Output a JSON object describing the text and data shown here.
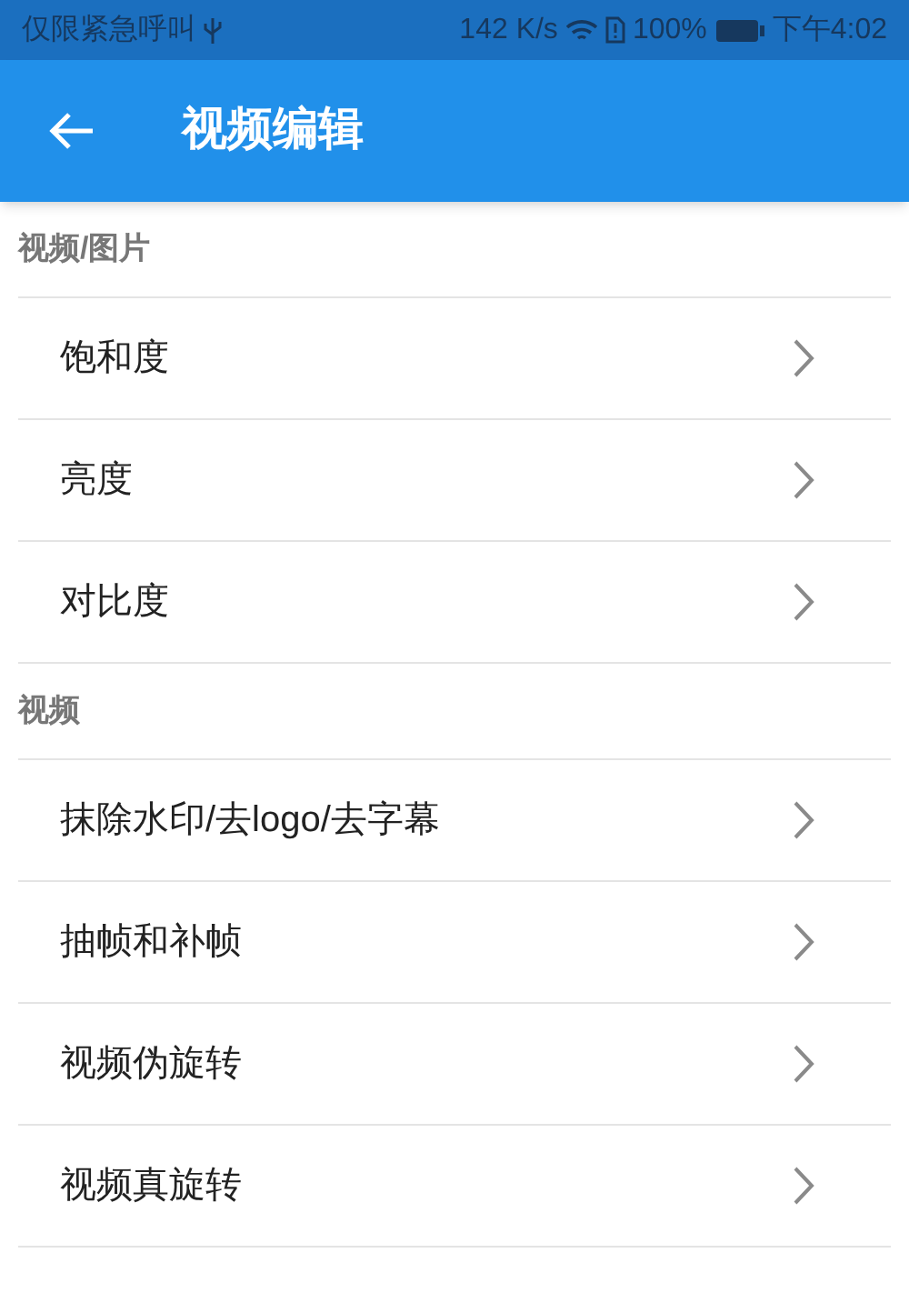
{
  "status_bar": {
    "carrier": "仅限紧急呼叫",
    "speed": "142 K/s",
    "battery": "100%",
    "time": "下午4:02"
  },
  "app_bar": {
    "title": "视频编辑"
  },
  "sections": [
    {
      "header": "视频/图片",
      "items": [
        {
          "label": "饱和度"
        },
        {
          "label": "亮度"
        },
        {
          "label": "对比度"
        }
      ]
    },
    {
      "header": "视频",
      "items": [
        {
          "label": "抹除水印/去logo/去字幕"
        },
        {
          "label": "抽帧和补帧"
        },
        {
          "label": "视频伪旋转"
        },
        {
          "label": "视频真旋转"
        }
      ]
    }
  ]
}
